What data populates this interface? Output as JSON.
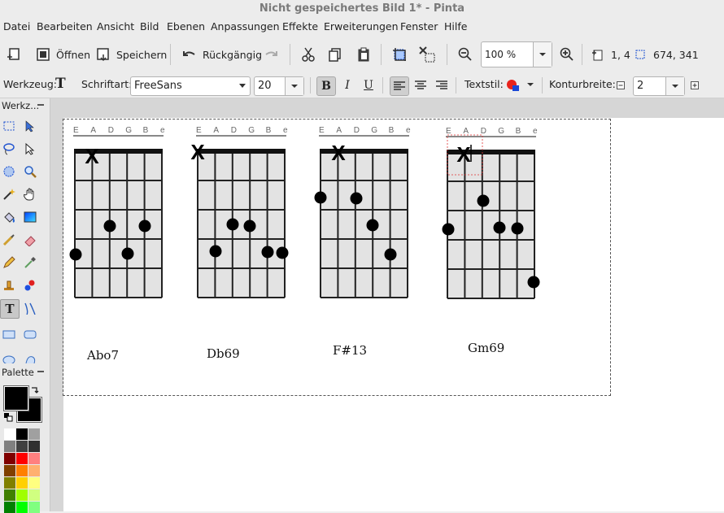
{
  "window": {
    "title": "Nicht gespeichertes Bild 1* - Pinta"
  },
  "menu": [
    "Datei",
    "Bearbeiten",
    "Ansicht",
    "Bild",
    "Ebenen",
    "Anpassungen",
    "Effekte",
    "Erweiterungen",
    "Fenster",
    "Hilfe"
  ],
  "toolbar": {
    "open_label": "Öffnen",
    "save_label": "Speichern",
    "undo_label": "Rückgängig",
    "zoom_value": "100 %",
    "cursor_position": "1, 4",
    "selection_size": "674, 341"
  },
  "text_toolbar": {
    "tool_label": "Werkzeug:",
    "font_label": "Schriftart:",
    "font_value": "FreeSans",
    "size_value": "20",
    "bold": "B",
    "italic": "I",
    "underline": "U",
    "textstyle_label": "Textstil:",
    "outline_label": "Konturbreite:",
    "outline_value": "2"
  },
  "panels": {
    "tools_title": "Werkz...",
    "palette_title": "Palette"
  },
  "palette_colors": [
    "#ffffff",
    "#000000",
    "#a0a0a0",
    "#808080",
    "#404040",
    "#303030",
    "#800000",
    "#ff0000",
    "#ff8080",
    "#804000",
    "#ff8000",
    "#ffb070",
    "#808000",
    "#ffd000",
    "#ffff80",
    "#408000",
    "#a0ff00",
    "#d0ff80",
    "#008000",
    "#00ff00",
    "#80ff80"
  ],
  "chords": {
    "strings": [
      "E",
      "A",
      "D",
      "G",
      "B",
      "e"
    ],
    "mute_mark": "X",
    "names": [
      "Abo7",
      "Db69",
      "F#13",
      "Gm69"
    ]
  }
}
